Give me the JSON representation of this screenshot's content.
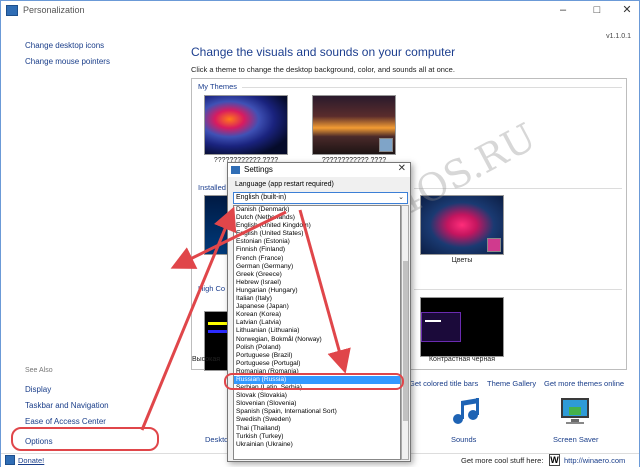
{
  "window": {
    "title": "Personalization",
    "version": "v1.1.0.1"
  },
  "sidebar": {
    "links": [
      {
        "label": "Change desktop icons"
      },
      {
        "label": "Change mouse pointers"
      }
    ],
    "see_also_heading": "See Also",
    "see_also": [
      {
        "label": "Display"
      },
      {
        "label": "Taskbar and Navigation"
      },
      {
        "label": "Ease of Access Center"
      },
      {
        "label": "Options"
      }
    ]
  },
  "main": {
    "heading": "Change the visuals and sounds on your computer",
    "subtext": "Click a theme to change the desktop background, color, and sounds all at once.",
    "sections": {
      "my_themes": "My Themes",
      "installed": "Installed",
      "high_contrast": "High Co"
    },
    "my_themes": [
      {
        "caption": "???????????? ????"
      },
      {
        "caption": "???????????? ????"
      }
    ],
    "installed_themes": [
      {
        "caption": "Цветы"
      }
    ],
    "high_contrast_themes": [
      {
        "caption": "Высокая"
      },
      {
        "caption": "Контрастная черная"
      }
    ],
    "links_row": [
      {
        "label": "Get colored title bars"
      },
      {
        "label": "Theme Gallery"
      },
      {
        "label": "Get more themes online"
      }
    ],
    "bottom_items": [
      {
        "label": "Desktop"
      },
      {
        "label": "Sounds"
      },
      {
        "label": "Screen Saver"
      }
    ]
  },
  "footer": {
    "donate": "Donate!",
    "more_cool": "Get more cool stuff here:",
    "logo_letter": "W",
    "url": "http://winaero.com"
  },
  "settings_dialog": {
    "title": "Settings",
    "language_label": "Language (app restart required)",
    "selected_value": "English (built-in)",
    "options": [
      "Danish (Denmark)",
      "Dutch (Netherlands)",
      "English (United Kingdom)",
      "English (United States)",
      "Estonian (Estonia)",
      "Finnish (Finland)",
      "French (France)",
      "German (Germany)",
      "Greek (Greece)",
      "Hebrew (Israel)",
      "Hungarian (Hungary)",
      "Italian (Italy)",
      "Japanese (Japan)",
      "Korean (Korea)",
      "Latvian (Latvia)",
      "Lithuanian (Lithuania)",
      "Norwegian, Bokmål (Norway)",
      "Polish (Poland)",
      "Portuguese (Brazil)",
      "Portuguese (Portugal)",
      "Romanian (Romania)",
      "Russian (Russia)",
      "Serbian (Latin, Serbia)",
      "Slovak (Slovakia)",
      "Slovenian (Slovenia)",
      "Spanish (Spain, International Sort)",
      "Swedish (Sweden)",
      "Thai (Thailand)",
      "Turkish (Turkey)",
      "Ukrainian (Ukraine)"
    ],
    "highlighted_option": "Russian (Russia)"
  },
  "watermark": "All4OS.RU",
  "colors": {
    "link": "#1a3e8a",
    "annotation_red": "#e0464a",
    "selection": "#3399ff"
  }
}
